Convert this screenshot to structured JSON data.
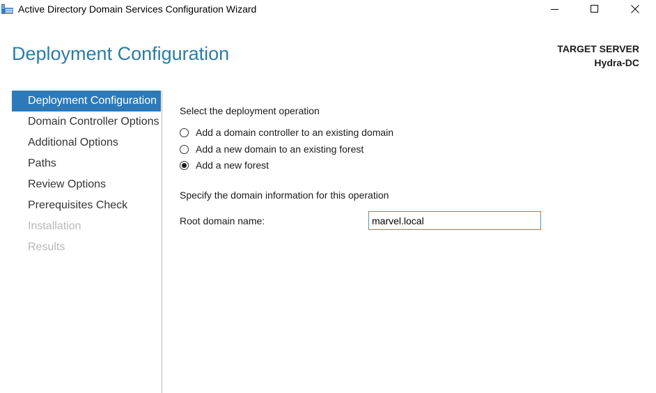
{
  "window": {
    "title": "Active Directory Domain Services Configuration Wizard",
    "controls": [
      "minimize",
      "maximize",
      "close"
    ]
  },
  "header": {
    "title": "Deployment Configuration",
    "target_label": "TARGET SERVER",
    "target_name": "Hydra-DC"
  },
  "nav": {
    "items": [
      {
        "label": "Deployment Configuration",
        "state": "active"
      },
      {
        "label": "Domain Controller Options",
        "state": "enabled"
      },
      {
        "label": "Additional Options",
        "state": "enabled"
      },
      {
        "label": "Paths",
        "state": "enabled"
      },
      {
        "label": "Review Options",
        "state": "enabled"
      },
      {
        "label": "Prerequisites Check",
        "state": "enabled"
      },
      {
        "label": "Installation",
        "state": "disabled"
      },
      {
        "label": "Results",
        "state": "disabled"
      }
    ]
  },
  "main": {
    "operation_heading": "Select the deployment operation",
    "options": [
      {
        "label": "Add a domain controller to an existing domain",
        "checked": false
      },
      {
        "label": "Add a new domain to an existing forest",
        "checked": false
      },
      {
        "label": "Add a new forest",
        "checked": true
      }
    ],
    "domain_heading": "Specify the domain information for this operation",
    "root_domain_label": "Root domain name:",
    "root_domain_value": "marvel.local"
  },
  "colors": {
    "accent": "#2e7ab8",
    "title": "#2b7ca8",
    "disabled_text": "#b8b8b8"
  }
}
